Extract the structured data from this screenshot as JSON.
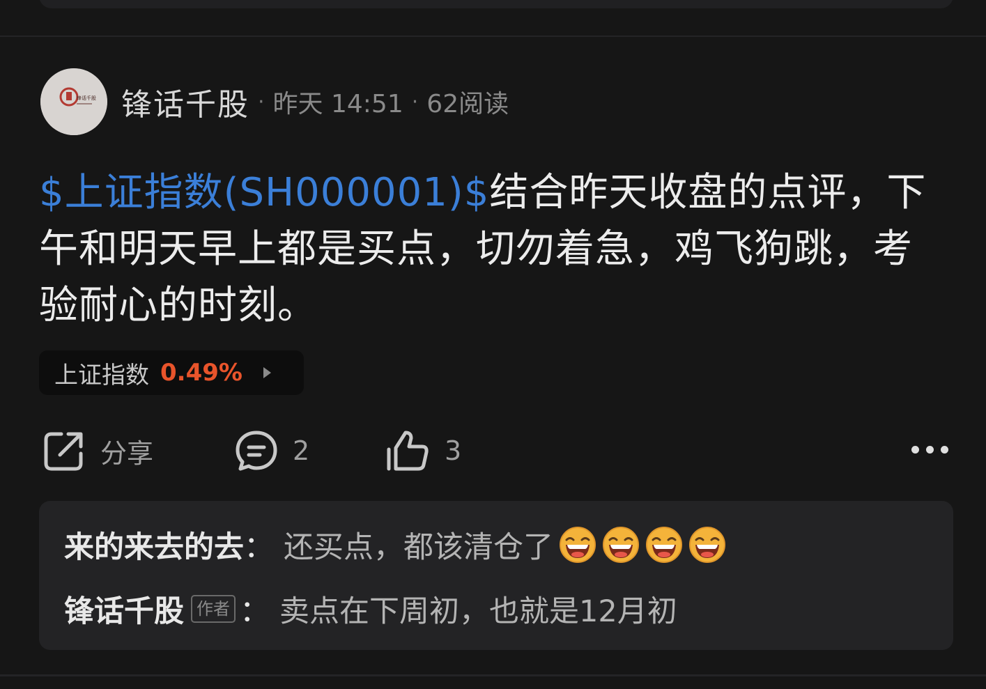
{
  "post": {
    "author": "锋话千股",
    "avatar_text": "锋话千股",
    "time": "昨天 14:51",
    "reads": "62阅读",
    "stock_link": "$上证指数(SH000001)$",
    "body": "结合昨天收盘的点评，下午和明天早上都是买点，切勿着急，鸡飞狗跳，考验耐心的时刻。"
  },
  "stock_chip": {
    "name": "上证指数",
    "change": "0.49%",
    "change_color": "#e8542b"
  },
  "actions": {
    "share_label": "分享",
    "comment_count": "2",
    "like_count": "3"
  },
  "comments": [
    {
      "author": "来的来去的去",
      "colon": "：",
      "text": "还买点，都该清仓了",
      "emoji": "laughing-face-icon",
      "emoji_count": 4
    },
    {
      "author": "锋话千股",
      "tag": "作者",
      "colon": "：",
      "text": "卖点在下周初，也就是12月初"
    }
  ],
  "colors": {
    "background": "#161616",
    "link": "#3b7fd8",
    "card": "#232325"
  }
}
